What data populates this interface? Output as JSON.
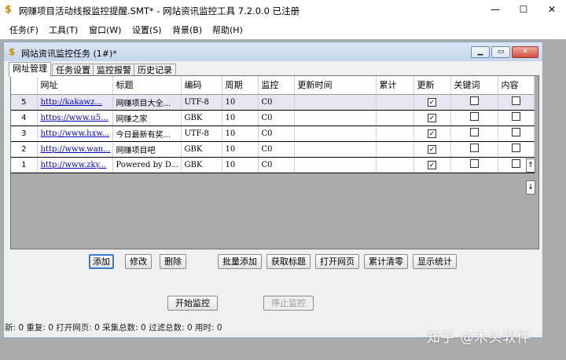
{
  "app": {
    "title": "网赚项目活动线报监控提醒.SMT* - 网站资讯监控工具 7.2.0.0 已注册",
    "min_label": "—",
    "max_label": "☐",
    "close_label": "✕"
  },
  "menu": [
    "任务(F)",
    "工具(T)",
    "窗口(W)",
    "设置(S)",
    "背景(B)",
    "帮助(H)"
  ],
  "child": {
    "title": "网站资讯监控任务 (1#)*",
    "tabs": [
      "网址管理",
      "任务设置",
      "监控报警",
      "历史记录"
    ],
    "active_tab": 0
  },
  "grid": {
    "columns": [
      "",
      "网址",
      "标题",
      "编码",
      "周期",
      "监控",
      "更新时间",
      "累计",
      "更新",
      "关键词",
      "内容"
    ],
    "rows": [
      {
        "idx": "5",
        "url": "http://kakawz...",
        "title": "网赚项目大全...",
        "enc": "UTF-8",
        "period": "10",
        "monitor": "C0",
        "time": "",
        "total": "",
        "update": true,
        "keyword": false,
        "content": false
      },
      {
        "idx": "4",
        "url": "https://www.u5...",
        "title": "网赚之家",
        "enc": "GBK",
        "period": "10",
        "monitor": "C0",
        "time": "",
        "total": "",
        "update": true,
        "keyword": false,
        "content": false
      },
      {
        "idx": "3",
        "url": "http://www.hxw...",
        "title": "今日最新有奖...",
        "enc": "UTF-8",
        "period": "10",
        "monitor": "C0",
        "time": "",
        "total": "",
        "update": true,
        "keyword": false,
        "content": false
      },
      {
        "idx": "2",
        "url": "http://www.wan...",
        "title": "网赚项目吧",
        "enc": "GBK",
        "period": "10",
        "monitor": "C0",
        "time": "",
        "total": "",
        "update": true,
        "keyword": false,
        "content": false
      },
      {
        "idx": "1",
        "url": "http://www.zky...",
        "title": "Powered by D...",
        "enc": "GBK",
        "period": "10",
        "monitor": "C0",
        "time": "",
        "total": "",
        "update": true,
        "keyword": false,
        "content": false
      }
    ],
    "selected_row": 0
  },
  "buttons": {
    "add": "添加",
    "edit": "修改",
    "delete": "删除",
    "batch_add": "批量添加",
    "fetch_title": "获取标题",
    "open_page": "打开网页",
    "clear_total": "累计清零",
    "show_stats": "显示统计",
    "start": "开始监控",
    "stop": "停止监控",
    "scroll_up": "↑",
    "scroll_down": "↓"
  },
  "status": "新: 0  重复: 0  打开网页: 0  采集总数: 0  过滤总数: 0  用时: 0",
  "watermark": "知乎 @木头软件",
  "colors": {
    "accent": "#3a78c9",
    "link": "#0000cc",
    "selected_row": "#e8e4f2",
    "mdi_bg": "#ababab"
  }
}
